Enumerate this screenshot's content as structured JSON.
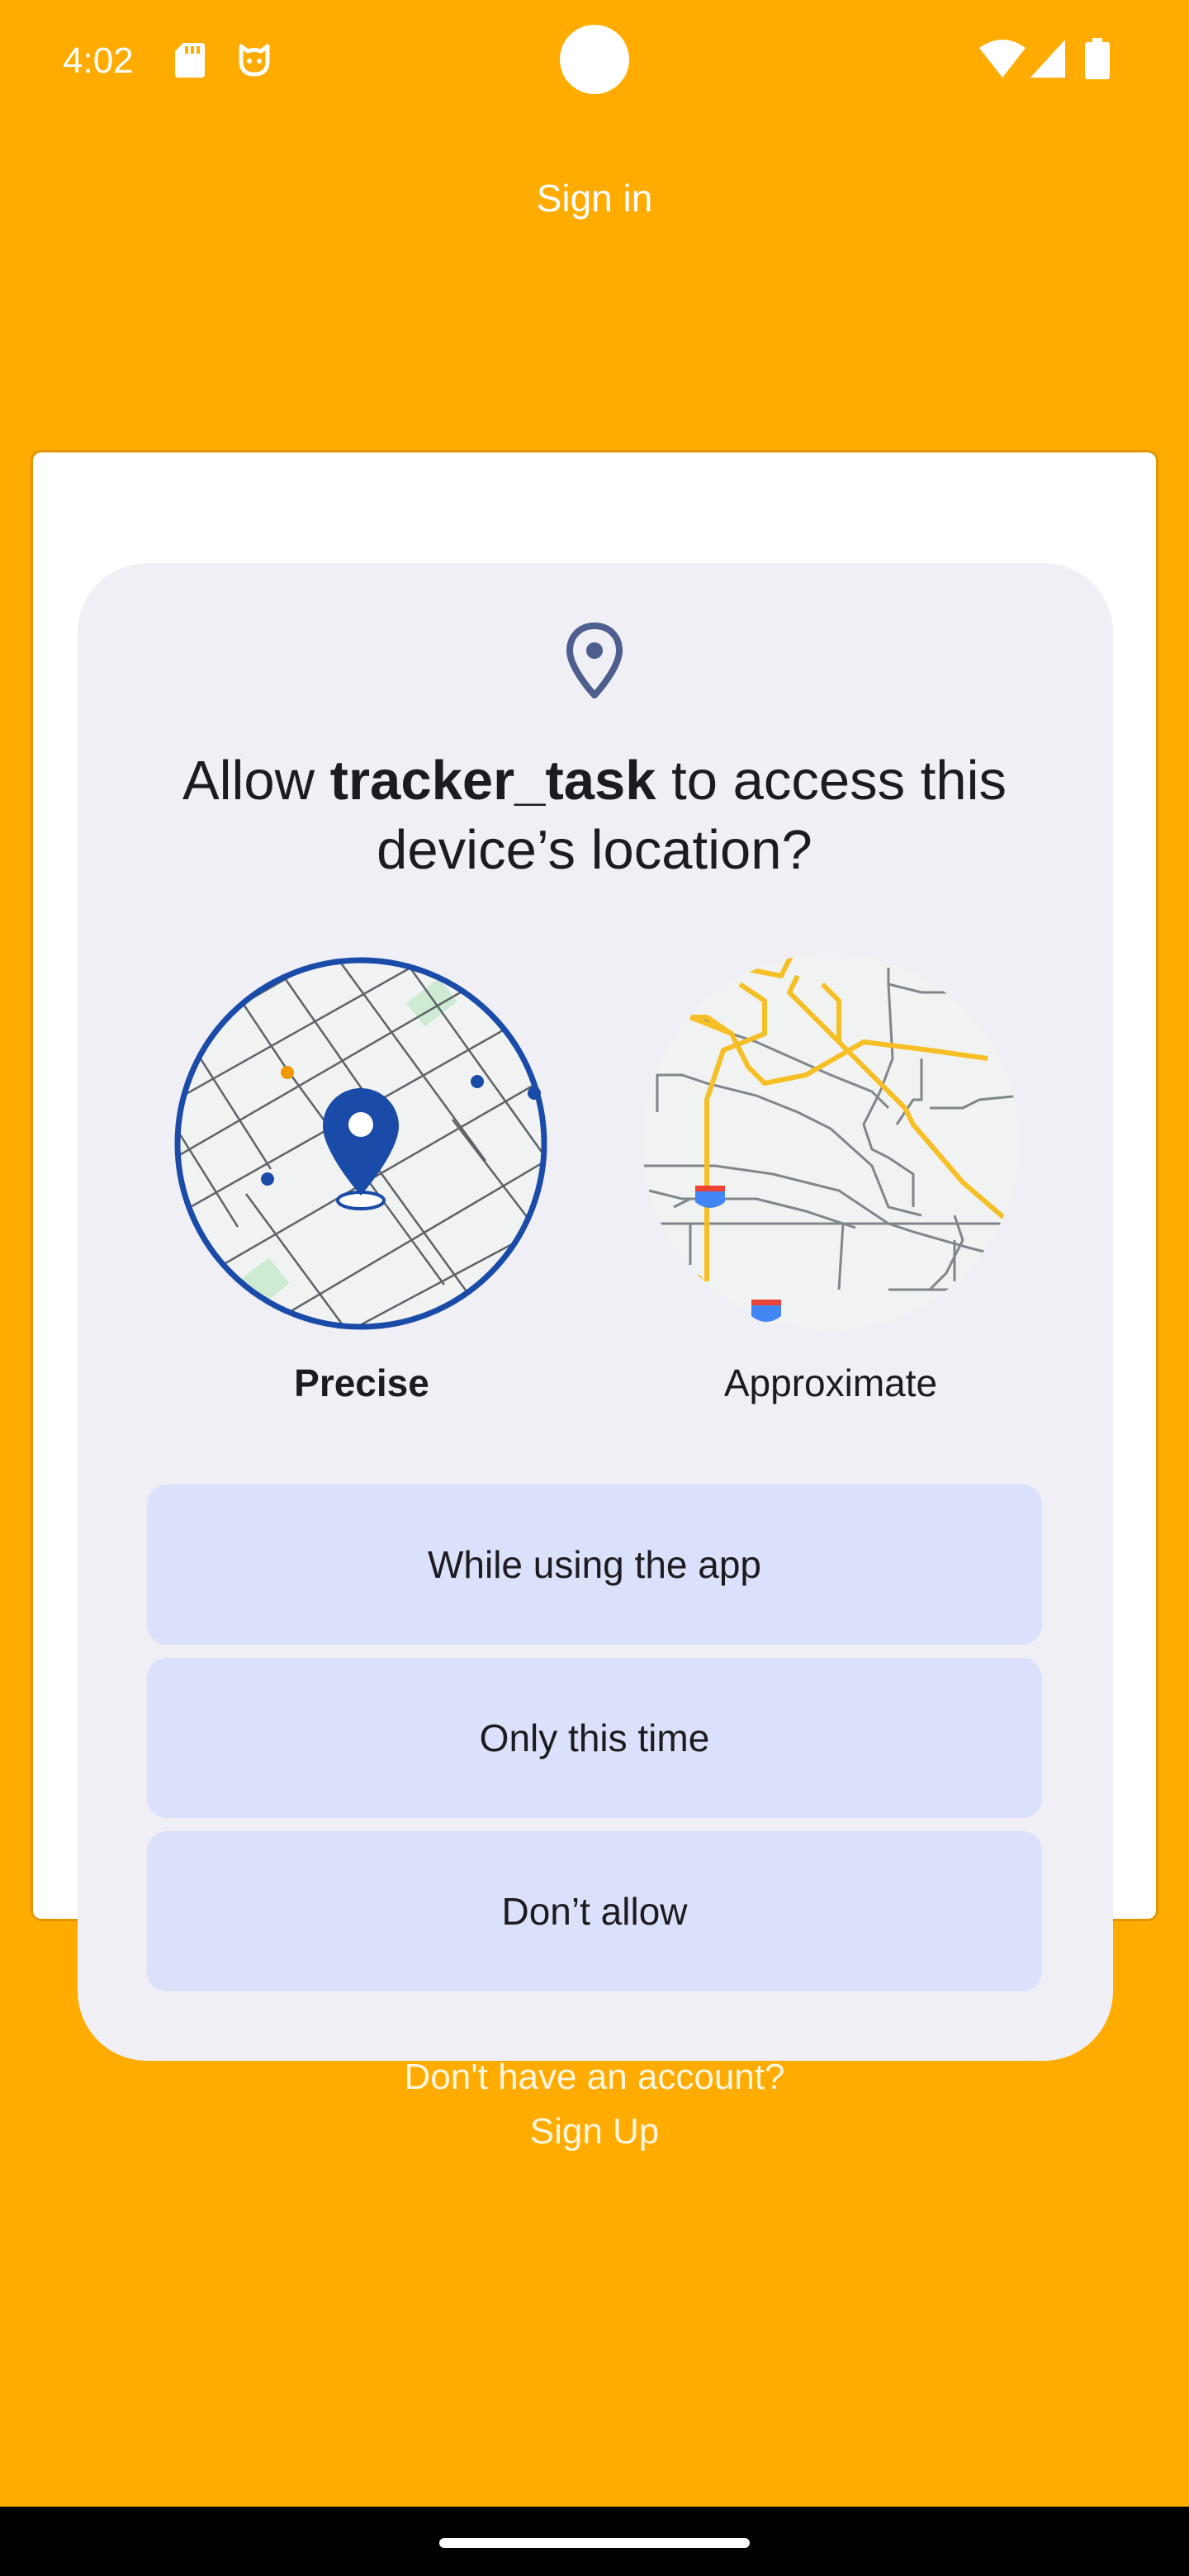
{
  "status_bar": {
    "time": "4:02",
    "icons": [
      "sd-card-icon",
      "cat-face-icon",
      "wifi-icon",
      "signal-icon",
      "battery-icon"
    ]
  },
  "app": {
    "title": "Sign in",
    "signup_question": "Don't have an account?",
    "signup_link": "Sign Up",
    "background_color": "#FFAB00"
  },
  "permission_dialog": {
    "icon": "location-pin-icon",
    "title_prefix": "Allow ",
    "app_name": "tracker_task",
    "title_suffix": " to access this device’s location?",
    "options": {
      "precise": "Precise",
      "approximate": "Approximate",
      "selected": "Precise"
    },
    "buttons": {
      "while_using": "While using the app",
      "only_this_time": "Only this time",
      "dont_allow": "Don’t allow"
    },
    "button_color": "#DBE1FA",
    "accent_color": "#1A4BA8"
  }
}
